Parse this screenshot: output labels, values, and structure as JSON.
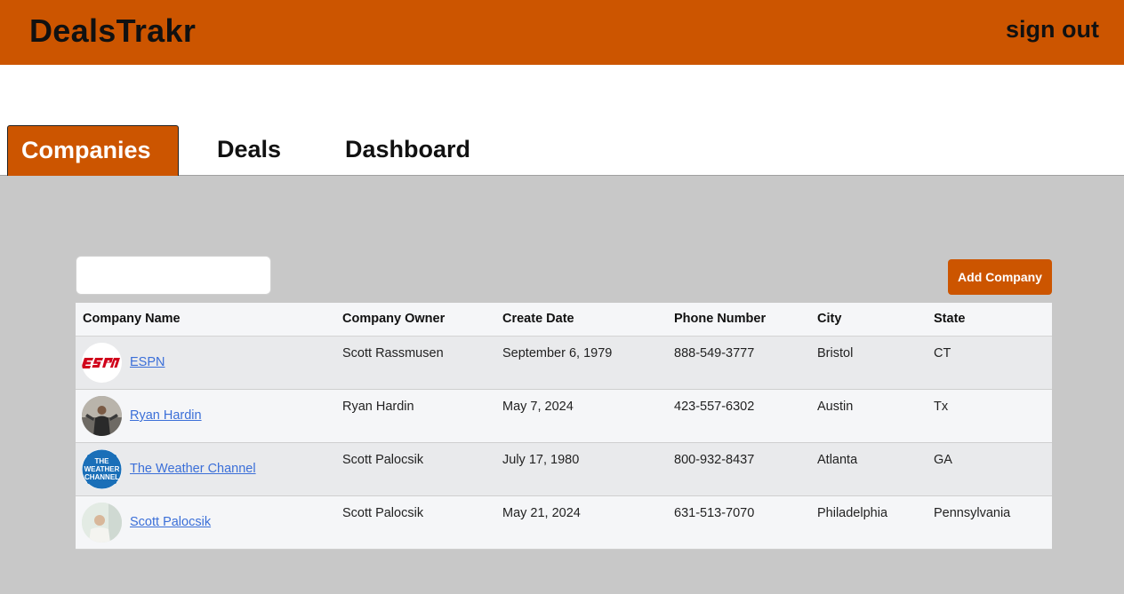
{
  "header": {
    "brand": "DealsTrakr",
    "sign_out": "sign out"
  },
  "tabs": [
    {
      "label": "Companies",
      "active": true
    },
    {
      "label": "Deals",
      "active": false
    },
    {
      "label": "Dashboard",
      "active": false
    }
  ],
  "search": {
    "value": "",
    "placeholder": ""
  },
  "add_company_label": "Add Company",
  "colors": {
    "accent": "#cc5500",
    "link": "#3b6fd8",
    "page_bg": "#c8c8c8"
  },
  "table": {
    "headers": [
      "Company Name",
      "Company Owner",
      "Create Date",
      "Phone Number",
      "City",
      "State"
    ],
    "rows": [
      {
        "name": "ESPN",
        "avatar_icon": "espn-logo-icon",
        "owner": "Scott Rassmusen",
        "date": "September 6, 1979",
        "phone": "888-549-3777",
        "city": "Bristol",
        "state": "CT"
      },
      {
        "name": "Ryan Hardin",
        "avatar_icon": "person-photo-icon",
        "owner": "Ryan Hardin",
        "date": "May 7, 2024",
        "phone": "423-557-6302",
        "city": "Austin",
        "state": "Tx"
      },
      {
        "name": "The Weather Channel",
        "avatar_icon": "weather-channel-logo-icon",
        "logo_lines": [
          "THE",
          "WEATHER",
          "CHANNEL"
        ],
        "owner": "Scott Palocsik",
        "date": "July 17, 1980",
        "phone": "800-932-8437",
        "city": "Atlanta",
        "state": "GA"
      },
      {
        "name": "Scott Palocsik",
        "avatar_icon": "person-photo-icon",
        "owner": "Scott Palocsik",
        "date": "May 21, 2024",
        "phone": "631-513-7070",
        "city": "Philadelphia",
        "state": "Pennsylvania"
      }
    ]
  }
}
